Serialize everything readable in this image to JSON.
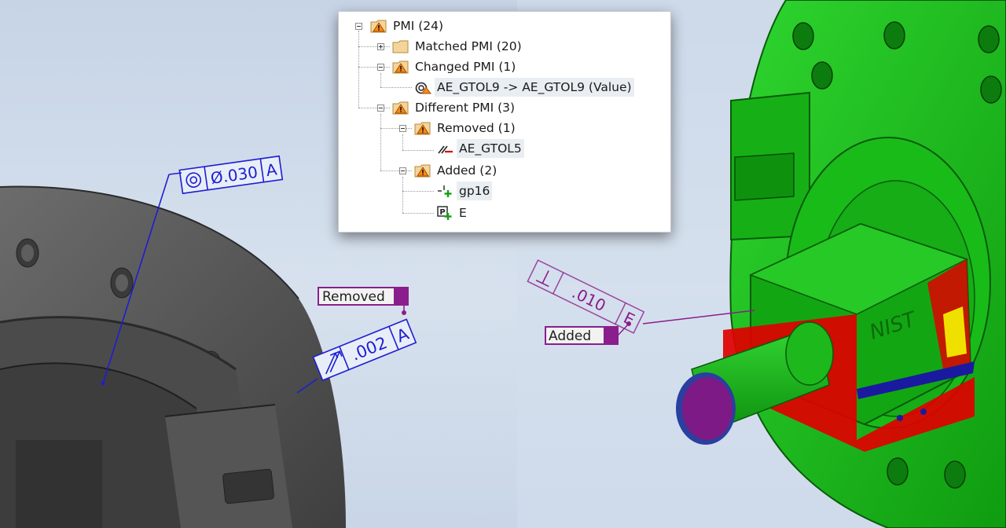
{
  "tree": {
    "root": "PMI (24)",
    "matched": "Matched PMI (20)",
    "changed": "Changed PMI (1)",
    "changed_item": "AE_GTOL9  -> AE_GTOL9  (Value)",
    "different": "Different PMI (3)",
    "removed": "Removed (1)",
    "removed_item": "AE_GTOL5",
    "added": "Added (2)",
    "added_item_1": "gp16",
    "added_item_2": "E"
  },
  "left_view": {
    "fcf_top": {
      "symbol": "position-symbol",
      "tolerance": "Ø.030",
      "datum": "A"
    },
    "fcf_runout": {
      "symbol": "total-runout-symbol",
      "tolerance": ".002",
      "datum": "A"
    },
    "tag": "Removed"
  },
  "right_view": {
    "fcf_perp": {
      "symbol": "perpendicularity-symbol",
      "tolerance": ".010",
      "datum": "E"
    },
    "tag": "Added",
    "engraving": "NIST"
  },
  "colors": {
    "left_part": "#5a5a5a",
    "right_part": "#14b814",
    "deviation_red": "#e00000",
    "annotation_blue": "#1e1ed2",
    "annotation_purple": "#8a1e8c",
    "warning_orange": "#f08a1c"
  }
}
